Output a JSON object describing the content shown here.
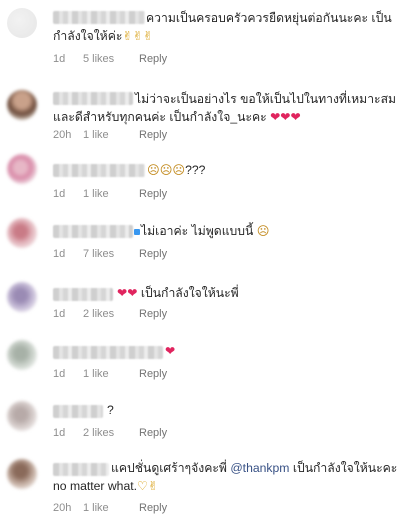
{
  "comments": [
    {
      "text": "ความเป็นครอบครัวควรยืดหยุ่นต่อกันนะคะ เป็นกำลังใจให้ค่ะ",
      "emoji": "✌✌✌",
      "time": "1d",
      "likes": "5 likes",
      "reply": "Reply"
    },
    {
      "text": "ไม่ว่าจะเป็นอย่างไร ขอให้เป็นไปในทางที่เหมาะสมและดีสำหรับทุกคนค่ะ เป็นกำลังใจ_นะคะ",
      "emoji": "❤❤❤",
      "time": "20h",
      "likes": "1 like",
      "reply": "Reply"
    },
    {
      "text": "???",
      "emoji": "☹☹☹",
      "time": "1d",
      "likes": "1 like",
      "reply": "Reply"
    },
    {
      "text": "ไม่เอาค่ะ ไม่พูดแบบนี้",
      "emoji": "☹",
      "time": "1d",
      "likes": "7 likes",
      "reply": "Reply"
    },
    {
      "text": "เป็นกำลังใจให้นะพี่",
      "emoji": "❤❤",
      "time": "1d",
      "likes": "2 likes",
      "reply": "Reply"
    },
    {
      "text": "",
      "emoji": "❤",
      "time": "1d",
      "likes": "1 like",
      "reply": "Reply"
    },
    {
      "text": "?",
      "emoji": "",
      "time": "1d",
      "likes": "2 likes",
      "reply": "Reply"
    },
    {
      "text_before": "แคปชั่นดูเศร้าๆจังคะพี่ ",
      "mention": "@thankpm",
      "text_after": " เป็นกำลังใจให้นะคะ no matter what.",
      "emoji": "♡✌",
      "time": "20h",
      "likes": "1 like",
      "reply": "Reply"
    }
  ]
}
